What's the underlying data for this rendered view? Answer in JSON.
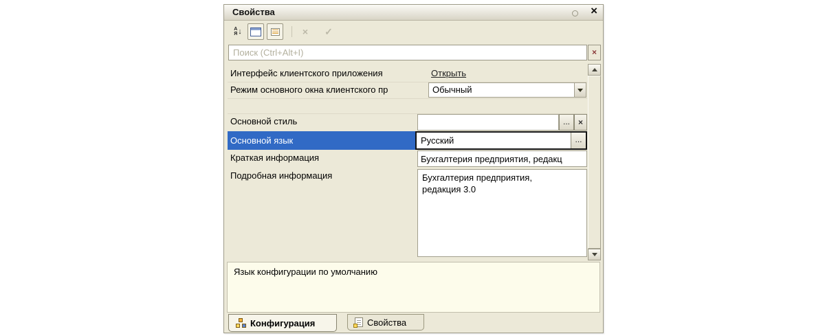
{
  "window": {
    "title": "Свойства"
  },
  "icons": {
    "close": "×",
    "clear": "×",
    "check": "✓",
    "sort_a": "А",
    "sort_z": "Я",
    "sort_arrow": "↓",
    "ellipsis": "..."
  },
  "search": {
    "placeholder": "Поиск (Ctrl+Alt+I)"
  },
  "grid": {
    "rows": [
      {
        "label": "Интерфейс клиентского приложения",
        "value": "Открыть",
        "type": "link"
      },
      {
        "label": "Режим основного окна клиентского пр",
        "value": "Обычный",
        "type": "combo"
      },
      {
        "label": "Основной стиль",
        "value": "",
        "type": "ellipsis-clear"
      },
      {
        "label": "Основной язык",
        "value": "Русский",
        "type": "ellipsis",
        "selected": true
      },
      {
        "label": "Краткая информация",
        "value": "Бухгалтерия предприятия, редакц",
        "type": "text"
      },
      {
        "label": "Подробная информация",
        "value": "Бухгалтерия предприятия,\nредакция 3.0",
        "type": "multiline"
      }
    ]
  },
  "description": {
    "text": "Язык конфигурации по умолчанию"
  },
  "tabs": [
    {
      "label": "Конфигурация"
    },
    {
      "label": "Свойства"
    }
  ],
  "colors": {
    "selection": "#316ac5",
    "panel_bg": "#ece9d8",
    "description_bg": "#fdfceb",
    "focus_border": "#141414"
  }
}
